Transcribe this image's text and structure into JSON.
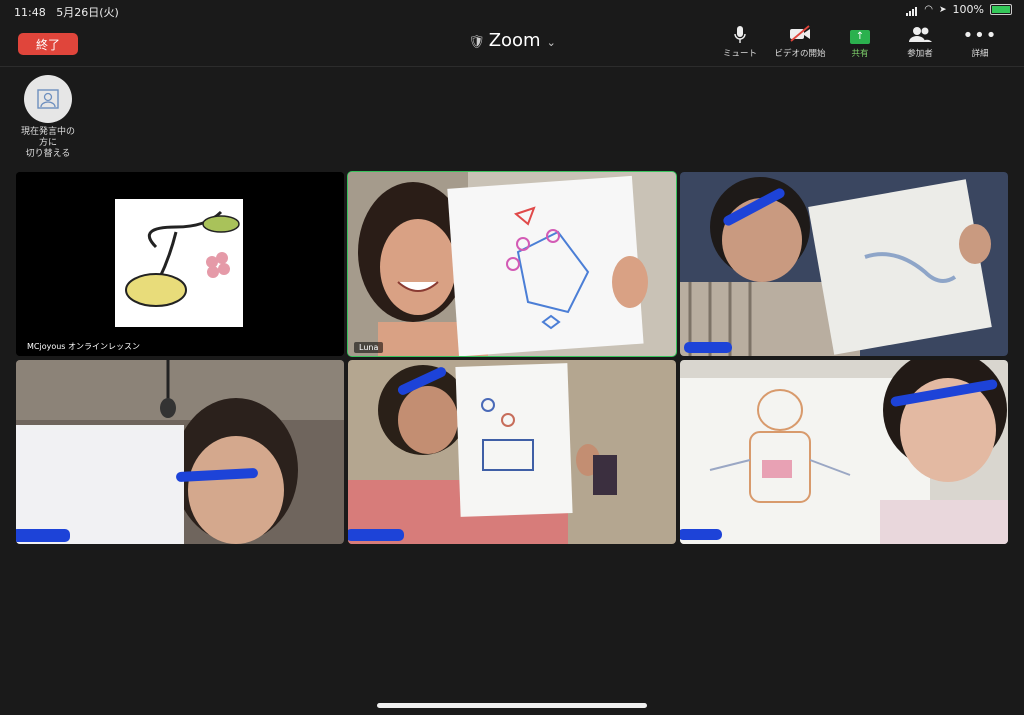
{
  "status_bar": {
    "time": "11:48",
    "date": "5月26日(火)",
    "battery_percent": "100%",
    "icons": [
      "cellular-icon",
      "wifi-icon",
      "location-icon",
      "battery-icon"
    ]
  },
  "toolbar": {
    "end_label": "終了",
    "title": "Zoom",
    "tools": [
      {
        "name": "mute",
        "label": "ミュート",
        "icon": "microphone-icon"
      },
      {
        "name": "start-video",
        "label": "ビデオの開始",
        "icon": "video-off-icon"
      },
      {
        "name": "share",
        "label": "共有",
        "icon": "share-screen-icon"
      },
      {
        "name": "participants",
        "label": "参加者",
        "icon": "participants-icon"
      },
      {
        "name": "more",
        "label": "詳細",
        "icon": "more-icon"
      }
    ]
  },
  "switch_view": {
    "label_line1": "現在発言中の",
    "label_line2": "方に",
    "label_line3": "切り替える",
    "icon": "speaker-view-icon"
  },
  "participants": [
    {
      "name": "MCjoyous オンラインレッスン",
      "active": false
    },
    {
      "name": "Luna",
      "active": true
    },
    {
      "name": "",
      "active": false
    },
    {
      "name": "",
      "active": false
    },
    {
      "name": "",
      "active": false
    },
    {
      "name": "",
      "active": false
    }
  ],
  "colors": {
    "end_button": "#e0453b",
    "active_speaker_border": "#39c25d",
    "share_green": "#2bb14e",
    "redaction_blue": "#1d43d8"
  }
}
